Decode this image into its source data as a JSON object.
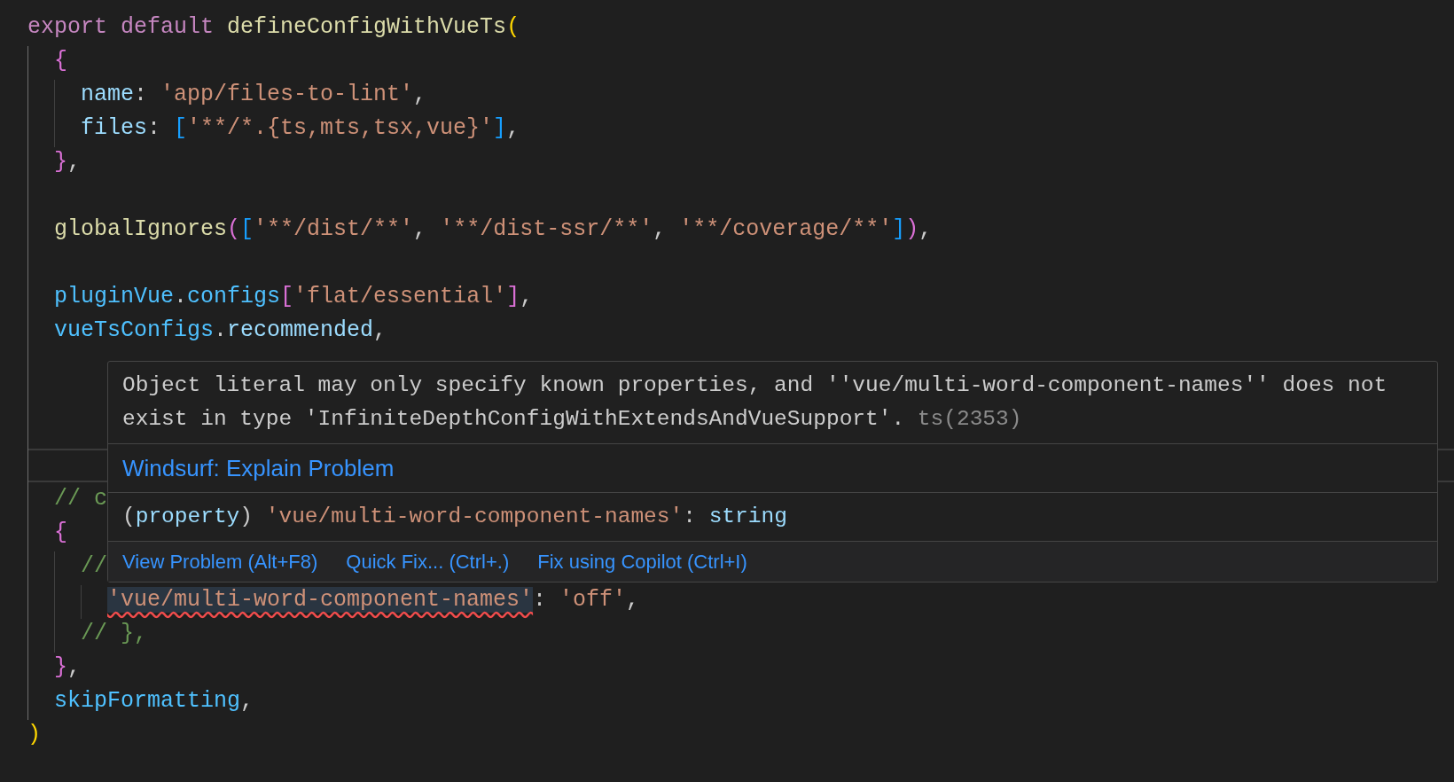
{
  "editor": {
    "lines": [
      {
        "current": false,
        "tokens": [
          {
            "kind": "keyword",
            "text": "export "
          },
          {
            "kind": "keyword",
            "text": "default "
          },
          {
            "kind": "function",
            "text": "defineConfigWithVueTs"
          },
          {
            "kind": "bracket1",
            "text": "("
          }
        ]
      },
      {
        "current": false,
        "tokens": [
          {
            "kind": "bracket2",
            "text": "  {"
          }
        ]
      },
      {
        "current": false,
        "tokens": [
          {
            "kind": "property",
            "text": "    name"
          },
          {
            "kind": "plain",
            "text": ": "
          },
          {
            "kind": "string",
            "text": "'app/files-to-lint'"
          },
          {
            "kind": "plain",
            "text": ","
          }
        ]
      },
      {
        "current": false,
        "tokens": [
          {
            "kind": "property",
            "text": "    files"
          },
          {
            "kind": "plain",
            "text": ": "
          },
          {
            "kind": "bracket3",
            "text": "["
          },
          {
            "kind": "string",
            "text": "'**/*.{ts,mts,tsx,vue}'"
          },
          {
            "kind": "bracket3",
            "text": "]"
          },
          {
            "kind": "plain",
            "text": ","
          }
        ]
      },
      {
        "current": false,
        "tokens": [
          {
            "kind": "bracket2",
            "text": "  }"
          },
          {
            "kind": "plain",
            "text": ","
          }
        ]
      },
      {
        "current": false
      },
      {
        "current": false,
        "tokens": [
          {
            "kind": "function",
            "text": "  globalIgnores"
          },
          {
            "kind": "bracket2",
            "text": "("
          },
          {
            "kind": "bracket3",
            "text": "["
          },
          {
            "kind": "string",
            "text": "'**/dist/**'"
          },
          {
            "kind": "plain",
            "text": ", "
          },
          {
            "kind": "string",
            "text": "'**/dist-ssr/**'"
          },
          {
            "kind": "plain",
            "text": ", "
          },
          {
            "kind": "string",
            "text": "'**/coverage/**'"
          },
          {
            "kind": "bracket3",
            "text": "]"
          },
          {
            "kind": "bracket2",
            "text": ")"
          },
          {
            "kind": "plain",
            "text": ","
          }
        ]
      },
      {
        "current": false
      },
      {
        "current": false,
        "tokens": [
          {
            "kind": "variable",
            "text": "  pluginVue"
          },
          {
            "kind": "plain",
            "text": "."
          },
          {
            "kind": "variable",
            "text": "configs"
          },
          {
            "kind": "bracket2",
            "text": "["
          },
          {
            "kind": "string",
            "text": "'flat/essential'"
          },
          {
            "kind": "bracket2",
            "text": "]"
          },
          {
            "kind": "plain",
            "text": ","
          }
        ]
      },
      {
        "current": false,
        "tokens": [
          {
            "kind": "variable",
            "text": "  vueTsConfigs"
          },
          {
            "kind": "plain",
            "text": "."
          },
          {
            "kind": "property",
            "text": "recommended"
          },
          {
            "kind": "plain",
            "text": ","
          }
        ]
      },
      {
        "current": false
      },
      {
        "current": false
      },
      {
        "current": false
      },
      {
        "current": true
      },
      {
        "current": false,
        "tokens": [
          {
            "kind": "comment",
            "text": "  // c"
          }
        ]
      },
      {
        "current": false,
        "tokens": [
          {
            "kind": "bracket2",
            "text": "  {"
          }
        ]
      },
      {
        "current": false,
        "tokens": [
          {
            "kind": "comment",
            "text": "    //"
          }
        ]
      },
      {
        "current": false,
        "tokens": [
          {
            "kind": "string",
            "text": "      'vue/multi-word-component-names'",
            "error": true
          },
          {
            "kind": "plain",
            "text": ": "
          },
          {
            "kind": "string",
            "text": "'off'"
          },
          {
            "kind": "plain",
            "text": ","
          }
        ]
      },
      {
        "current": false,
        "tokens": [
          {
            "kind": "comment",
            "text": "    // },"
          }
        ]
      },
      {
        "current": false,
        "tokens": [
          {
            "kind": "bracket2",
            "text": "  }"
          },
          {
            "kind": "plain",
            "text": ","
          }
        ]
      },
      {
        "current": false,
        "tokens": [
          {
            "kind": "variable",
            "text": "  skipFormatting"
          },
          {
            "kind": "plain",
            "text": ","
          }
        ]
      },
      {
        "current": false,
        "tokens": [
          {
            "kind": "bracket1",
            "text": ")"
          }
        ]
      }
    ]
  },
  "hover": {
    "message": "Object literal may only specify known properties, and ''vue/multi-word-component-names'' does not exist in type 'InfiniteDepthConfigWithExtendsAndVueSupport'.",
    "error_code": "ts(2353)",
    "explain_link": "Windsurf: Explain Problem",
    "signature": [
      {
        "kind": "plain",
        "text": "("
      },
      {
        "kind": "property",
        "text": "property"
      },
      {
        "kind": "plain",
        "text": ") "
      },
      {
        "kind": "string",
        "text": "'vue/multi-word-component-names'"
      },
      {
        "kind": "plain",
        "text": ": "
      },
      {
        "kind": "property",
        "text": "string"
      }
    ],
    "actions": [
      "View Problem (Alt+F8)",
      "Quick Fix... (Ctrl+.)",
      "Fix using Copilot (Ctrl+I)"
    ]
  }
}
